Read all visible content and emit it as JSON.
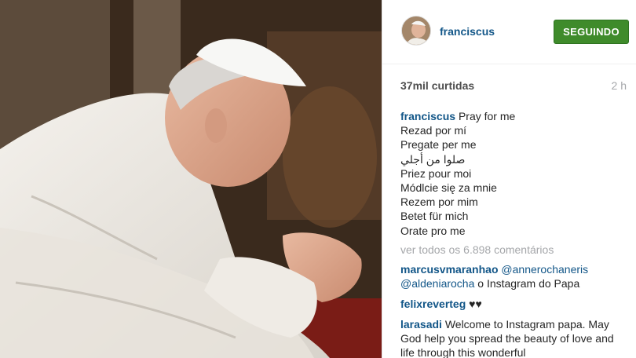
{
  "post": {
    "username": "franciscus",
    "follow_label": "SEGUINDO",
    "likes": "37mil curtidas",
    "time": "2 h",
    "caption_lines": [
      "Pray for me",
      "Rezad por mí",
      "Pregate per me",
      "صلوا من أجلي",
      "Priez pour moi",
      "Módlcie się za mnie",
      "Rezem por mim",
      "Betet für mich",
      "Orate pro me"
    ],
    "view_all": "ver todos os 6.898 comentários"
  },
  "comments": [
    {
      "user": "marcusvmaranhao",
      "mention1": "@annerochaneris",
      "mention2": "@aldeniarocha",
      "text": " o Instagram do Papa"
    },
    {
      "user": "felixreverteg",
      "text": " ♥♥"
    },
    {
      "user": "larasadi",
      "text": " Welcome to Instagram papa. May God help you spread the beauty of love and life through this wonderful"
    }
  ]
}
